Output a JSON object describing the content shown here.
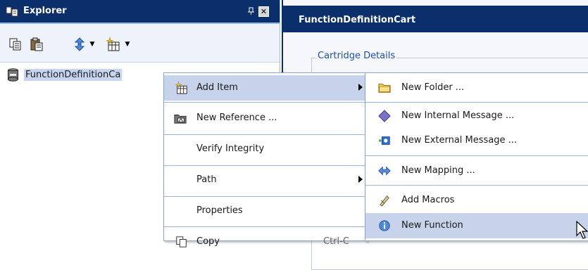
{
  "explorer": {
    "title": "Explorer",
    "pin_glyph": "₄",
    "close_glyph": "✕",
    "toolbar": {
      "icons": [
        "copy-icon",
        "paste-icon",
        "sync-icon",
        "add-item-icon"
      ]
    },
    "tree": {
      "root_label": "FunctionDefinitionCa"
    }
  },
  "cart": {
    "title": "FunctionDefinitionCart",
    "section_label": "Cartridge Details"
  },
  "context_menu": {
    "items": [
      {
        "label": "Add Item",
        "icon": "add-item-icon",
        "submenu": true,
        "highlighted": true
      },
      {
        "label": "New Reference ...",
        "icon": "reference-icon"
      },
      {
        "label": "Verify Integrity"
      },
      {
        "label": "Path",
        "submenu": true
      },
      {
        "label": "Properties"
      },
      {
        "label": "Copy",
        "shortcut": "Ctrl-C",
        "icon": "copy-icon"
      }
    ]
  },
  "submenu": {
    "items": [
      {
        "label": "New Folder ...",
        "icon": "folder-icon"
      },
      {
        "label": "New Internal Message ...",
        "icon": "internal-message-icon"
      },
      {
        "label": "New External Message ...",
        "icon": "external-message-icon"
      },
      {
        "label": "New Mapping ...",
        "icon": "mapping-icon"
      },
      {
        "label": "Add Macros",
        "icon": "macros-icon"
      },
      {
        "label": "New Function",
        "icon": "function-icon",
        "highlighted": true
      }
    ]
  },
  "colors": {
    "title_bar": "#0b2f6b",
    "highlight": "#c7d3ea",
    "separator": "#9fb3d2"
  }
}
